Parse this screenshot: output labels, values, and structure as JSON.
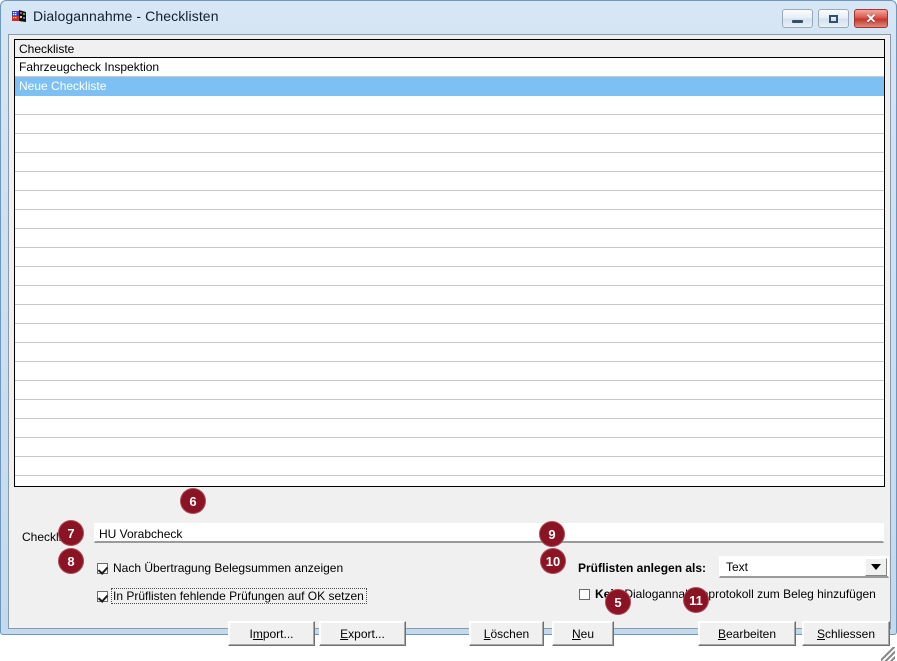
{
  "window": {
    "title": "Dialogannahme - Checklisten",
    "icon": "app-flag-icon",
    "controls": {
      "minimize": "minimize-icon",
      "maximize": "maximize-icon",
      "close": "✕"
    }
  },
  "list": {
    "header": "Checkliste",
    "rows": [
      {
        "label": "Fahrzeugcheck Inspektion",
        "selected": false
      },
      {
        "label": "Neue Checkliste",
        "selected": true
      }
    ],
    "empty_row_count": 21
  },
  "form": {
    "checkliste_label": "Checkliste",
    "checkliste_value": "HU Vorabcheck",
    "checkliste_placeholder": "",
    "checkbox_uebertragung": {
      "label": "Nach Übertragung Belegsummen anzeigen",
      "checked": true
    },
    "checkbox_prueflisten_ok": {
      "label": "In Prüflisten fehlende Prüfungen auf OK setzen",
      "checked": true
    },
    "prueflisten_label": "Prüflisten anlegen als:",
    "prueflisten_value": "Text",
    "prueflisten_options": [
      "Text"
    ],
    "checkbox_kein_protokoll": {
      "bold_prefix": "Kein",
      "label": " Dialogannahmeprotokoll zum Beleg hinzufügen",
      "checked": false
    }
  },
  "buttons": {
    "import": {
      "pre": "I",
      "mnemonic": "m",
      "post": "port..."
    },
    "export": {
      "pre": "",
      "mnemonic": "E",
      "post": "xport..."
    },
    "loeschen": {
      "pre": "",
      "mnemonic": "L",
      "post": "öschen"
    },
    "neu": {
      "pre": "",
      "mnemonic": "N",
      "post": "eu"
    },
    "bearbeiten": {
      "pre": "",
      "mnemonic": "B",
      "post": "earbeiten"
    },
    "schliessen": {
      "pre": "",
      "mnemonic": "S",
      "post": "chliessen"
    }
  },
  "callouts": {
    "c5": "5",
    "c6": "6",
    "c7": "7",
    "c8": "8",
    "c9": "9",
    "c10": "10",
    "c11": "11"
  },
  "colors": {
    "callout_badge": "#8c1323",
    "selection": "#7cc0f4",
    "window_frame": "#6e97bf",
    "client_background": "#f0f0f0"
  }
}
